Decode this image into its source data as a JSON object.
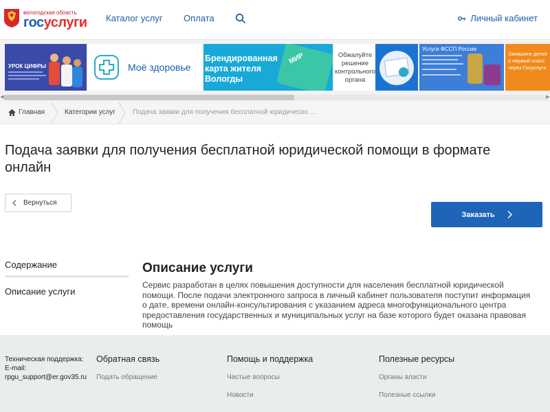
{
  "header": {
    "logo_region": "вологодская область",
    "logo_gos": "гос",
    "logo_uslugi": "услуги",
    "nav": [
      "Каталог услуг",
      "Оплата"
    ],
    "cabinet": "Личный кабинет"
  },
  "banners": [
    {
      "id": "urok",
      "text": "УРОК ЦИФРЫ",
      "bg": "#3a4aa8"
    },
    {
      "id": "health",
      "text": "Моё здоровье",
      "bg": "#ffffff"
    },
    {
      "id": "card",
      "text": "Брендированная карта жителя Вологды",
      "bg": "#18a9d8"
    },
    {
      "id": "appeal",
      "text": "Обжалуйте решение контрольного органа",
      "bg": "#1b73d1"
    },
    {
      "id": "fssp",
      "text": "Услуги ФССП России",
      "bg": "#3c7ed8"
    },
    {
      "id": "school",
      "text": "Запишите детей в первый класс через Госуслуги",
      "bg": "#f08a1c"
    }
  ],
  "breadcrumbs": [
    "Главная",
    "Категории услуг",
    "Подача заявки для получения бесплатной юридическо ..."
  ],
  "page": {
    "title": "Подача заявки для получения бесплатной юридической помощи в формате онлайн",
    "back": "Вернуться",
    "order": "Заказать"
  },
  "sidebar": [
    "Содержание",
    "Описание услуги"
  ],
  "section": {
    "title": "Описание услуги",
    "text": "Сервис разработан в целях повышения доступности для населения бесплатной юридической помощи. После подачи электронного запроса в личный кабинет пользователя поступит информация о дате, времени онлайн-консультирования с указанием адреса многофункционального центра предоставления государственных и муниципальных услуг на базе которого будет оказана правовая помощь"
  },
  "footer": {
    "support_label": "Техническая поддержка:",
    "email_label": "E-mail:",
    "email": "rpgu_support@er.gov35.ru",
    "col1_title": "Обратная связь",
    "col1_links": [
      "Подать обращение"
    ],
    "col2_title": "Помощь и поддержка",
    "col2_links": [
      "Частые вопросы",
      "Новости"
    ],
    "col3_title": "Полезные ресурсы",
    "col3_links": [
      "Органы власти",
      "Полезные ссылки"
    ]
  }
}
